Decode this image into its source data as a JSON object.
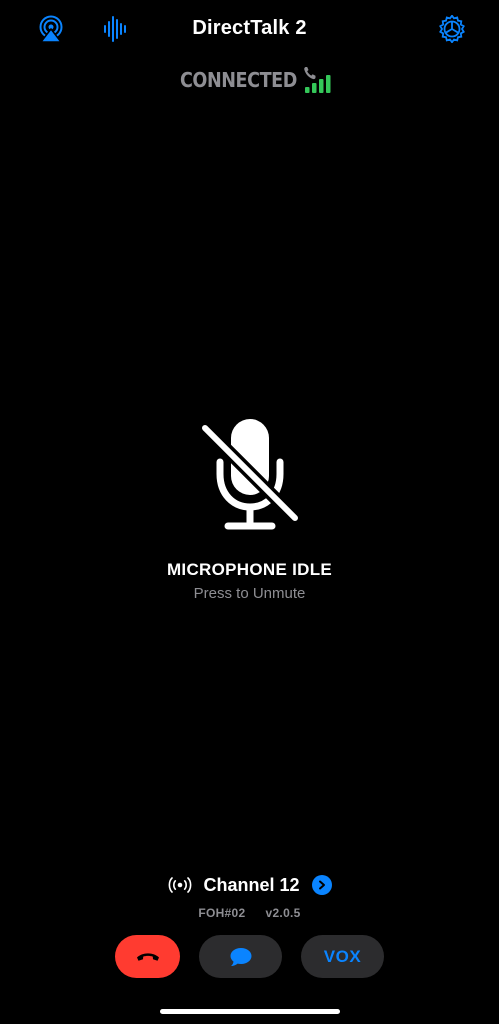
{
  "header": {
    "title": "DirectTalk 2",
    "status": "CONNECTED",
    "left_icons": [
      "airplay-icon",
      "audio-waveform-icon"
    ],
    "right_icon": "gear-icon",
    "signal_icon": "phone-signal-icon"
  },
  "mic": {
    "icon": "microphone-slash-icon",
    "state": "MICROPHONE IDLE",
    "hint": "Press to Unmute"
  },
  "channel": {
    "icon": "broadcast-icon",
    "label": "Channel 12",
    "chevron_icon": "chevron-right-icon",
    "station": "FOH#02",
    "version": "v2.0.5"
  },
  "controls": {
    "hangup_icon": "phone-hangup-icon",
    "chat_icon": "speech-bubble-icon",
    "vox_label": "VOX"
  },
  "colors": {
    "background": "#000000",
    "accent": "#0a84ff",
    "danger": "#ff3b30",
    "connected_green": "#34c759",
    "secondary_text": "#8e8e93",
    "button_bg": "#2c2c2e"
  }
}
